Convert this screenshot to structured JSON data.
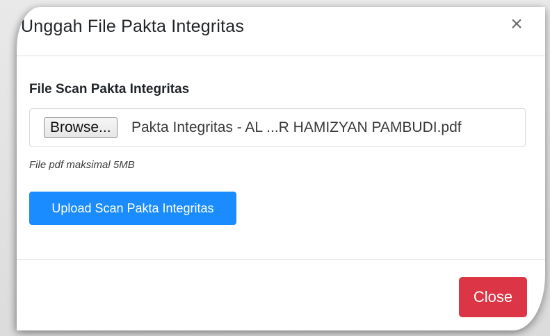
{
  "modal": {
    "title": "Unggah File Pakta Integritas",
    "close_symbol": "×"
  },
  "form": {
    "label": "File Scan Pakta Integritas",
    "browse_label": "Browse...",
    "selected_file": "Pakta Integritas - AL ...R HAMIZYAN PAMBUDI.pdf",
    "help_text": "File pdf maksimal 5MB",
    "upload_label": "Upload Scan Pakta Integritas"
  },
  "footer": {
    "close_label": "Close"
  },
  "colors": {
    "primary": "#1a8cff",
    "danger": "#dc3545"
  },
  "icons": {
    "close": "close-icon"
  }
}
